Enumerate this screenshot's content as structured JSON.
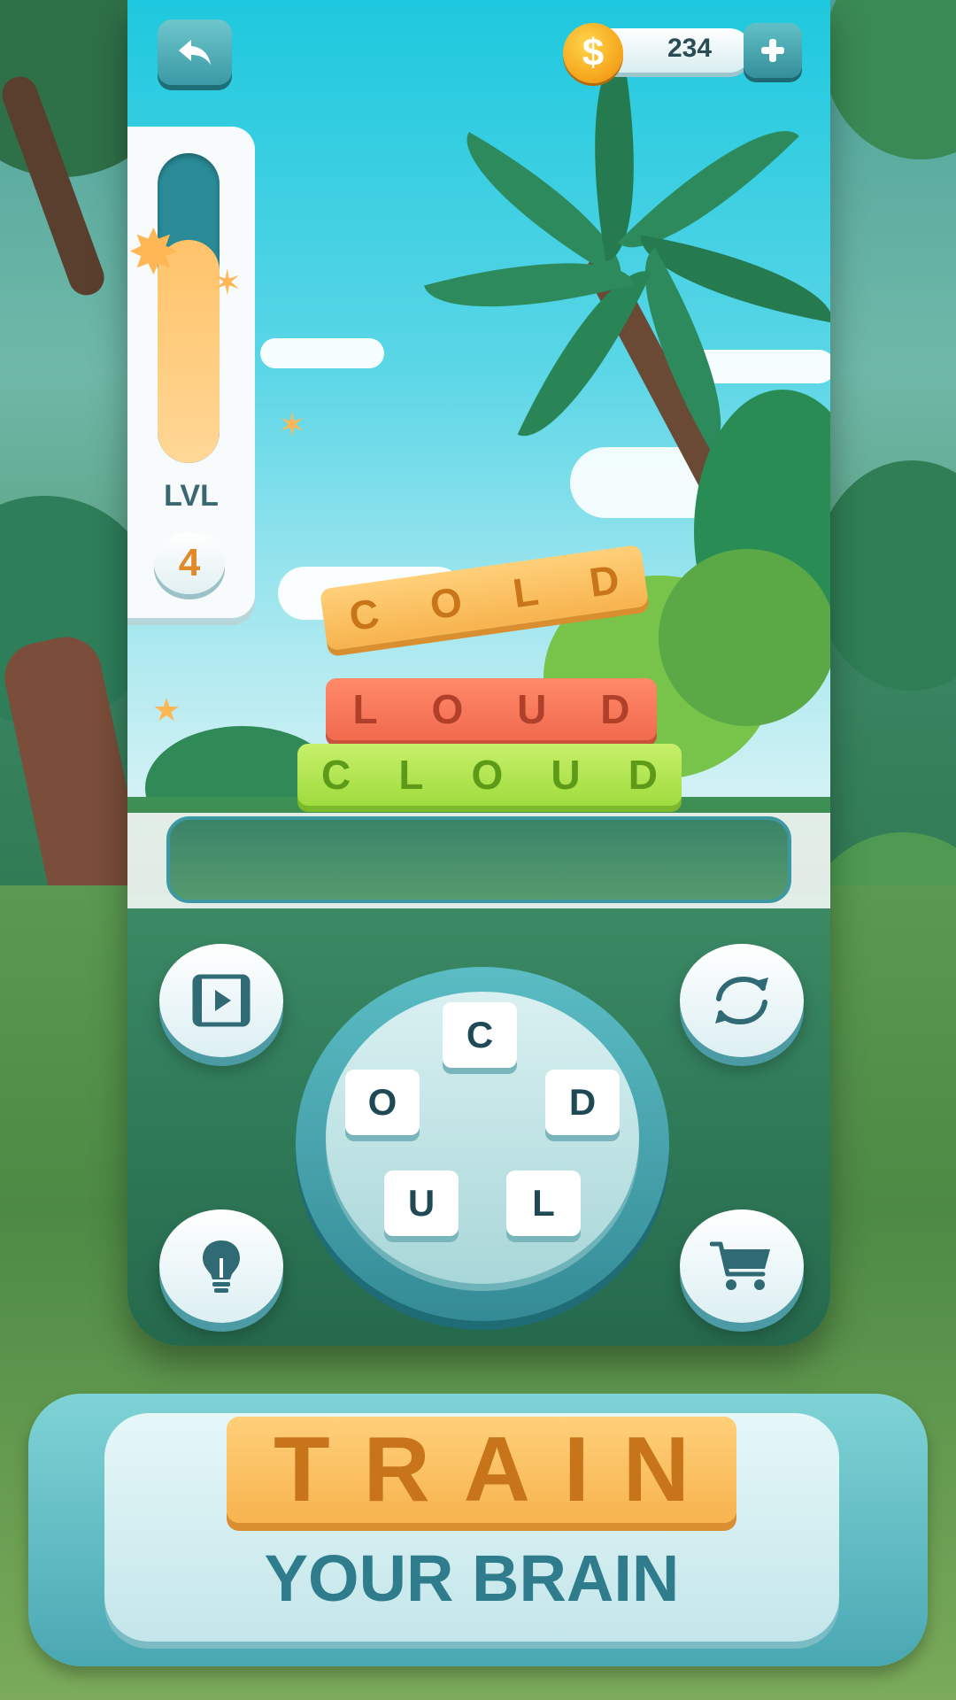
{
  "header": {
    "back_icon": "back-arrow-icon",
    "coins": "234",
    "coin_symbol": "$",
    "add_icon": "plus-icon"
  },
  "level": {
    "label": "LVL",
    "number": "4",
    "progress": 0.72
  },
  "found_words": [
    {
      "word": "COLD",
      "letters": [
        "C",
        "O",
        "L",
        "D"
      ]
    },
    {
      "word": "LOUD",
      "letters": [
        "L",
        "O",
        "U",
        "D"
      ]
    },
    {
      "word": "CLOUD",
      "letters": [
        "C",
        "L",
        "O",
        "U",
        "D"
      ]
    }
  ],
  "answer": {
    "current": ""
  },
  "buttons": {
    "video_icon": "video-play-icon",
    "shuffle_icon": "shuffle-icon",
    "hint_icon": "lightbulb-icon",
    "shop_icon": "shopping-cart-icon"
  },
  "wheel": {
    "letters": [
      "C",
      "O",
      "D",
      "U",
      "L"
    ]
  },
  "banner": {
    "title": "TRAIN",
    "subtitle": "YOUR BRAIN"
  },
  "colors": {
    "accent_teal": "#3a9aa5",
    "tile_orange": "#f7b34e",
    "tile_red": "#f16a4e",
    "tile_green": "#9fdc3e",
    "coin_gold": "#f5a31a"
  }
}
